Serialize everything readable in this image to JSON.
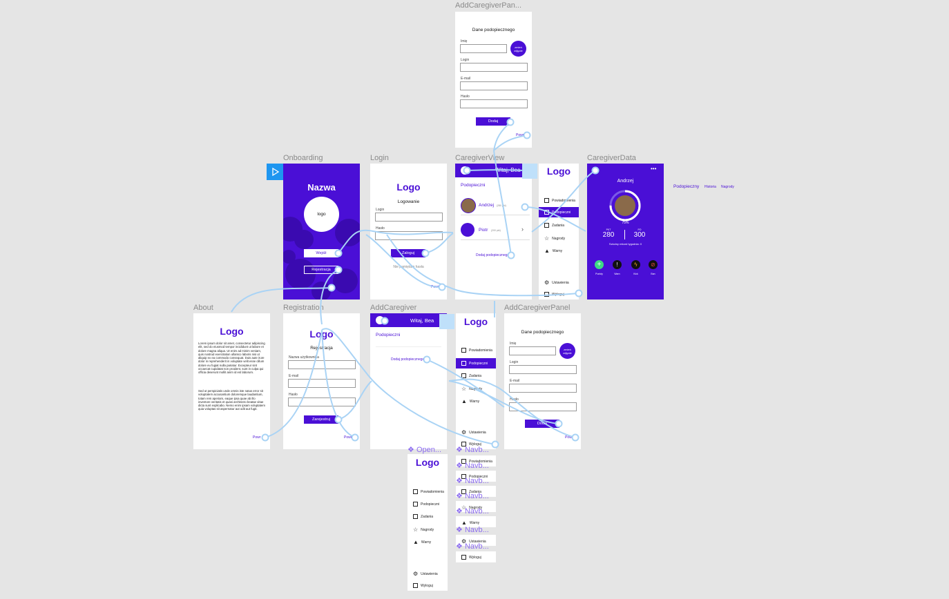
{
  "frames": {
    "add_caregiver_panel_top": "AddCaregiverPan...",
    "onboarding": "Onboarding",
    "login": "Login",
    "caregiver_view": "CaregiverView",
    "caregiver_data": "CaregiverData",
    "about": "About",
    "registration": "Registration",
    "add_caregiver": "AddCaregiver",
    "add_caregiver_panel": "AddCaregiverPanel"
  },
  "components": [
    "Open...",
    "Navb...",
    "Navb...",
    "Navb...",
    "Navb...",
    "Navb...",
    "Navb..."
  ],
  "onboarding": {
    "title": "Nazwa",
    "logo": "logo",
    "enter": "Wejdź",
    "register": "Rejestracja"
  },
  "login": {
    "logo": "Logo",
    "heading": "Logowanie",
    "login_label": "Login",
    "password_label": "Hasło",
    "submit": "Zaloguj",
    "forgot": "Nie pamiętam hasła",
    "back": "Powr"
  },
  "caregiver_view": {
    "greeting": "Witaj, Bea",
    "section": "Podopieczni",
    "wards": [
      {
        "name": "Andrzej",
        "points": "(280 pkt)"
      },
      {
        "name": "Piotr",
        "points": "(200 pkt)"
      }
    ],
    "add": "Dodaj podopiecznego"
  },
  "sidebar": {
    "logo": "Logo",
    "items": [
      "Powiadomienia",
      "Podopieczni",
      "Zadania",
      "Nagrody",
      "Warny"
    ],
    "settings": "Ustawienia",
    "logout": "Wyloguj"
  },
  "caregiver_data": {
    "name": "Andrzej",
    "percent": "75%",
    "pkt_label": "PKT",
    "pkt": "280",
    "po_label": "PO",
    "po": "300",
    "week": "Szkolny rekord tygodnia: 0",
    "actions": [
      "Punkty",
      "Warn",
      "Kick",
      "Ban"
    ],
    "tabs": [
      "Podopieczny",
      "Historia",
      "Nagrody"
    ]
  },
  "about": {
    "logo": "Logo",
    "p1": "Lorem ipsum dolor sit amet, consectetur adipiscing elit, sed do eiusmod tempor incididunt ut labore et dolore magna aliqua. Ut enim ad minim veniam, quis nostrud exercitation ullamco laboris nisi ut aliquip ex ea commodo consequat. Duis aute irure dolor in reprehenderit in voluptate velit esse cillum dolore eu fugiat nulla pariatur. Excepteur sint occaecat cupidatat non proident, sunt in culpa qui officia deserunt mollit anim id est laborum.",
    "p2": "Sed ut perspiciatis unde omnis iste natus error sit voluptatem accusantium doloremque laudantium, totam rem aperiam, eaque ipsa quae ab illo inventore veritatis et quasi architecto beatae vitae dicta sunt explicabo. Nemo enim ipsam voluptatem quia voluptas sit aspernatur aut odit aut fugit.",
    "back": "Powr"
  },
  "registration": {
    "logo": "Logo",
    "heading": "Rejestracja",
    "name_label": "Nazwa użytkownika",
    "email_label": "E-mail",
    "password_label": "Hasło",
    "submit": "Zarejestruj",
    "back": "Powr"
  },
  "add_caregiver": {
    "greeting": "Witaj, Bea",
    "section": "Podopieczni",
    "add": "Dodaj podopiecznego"
  },
  "panel": {
    "heading": "Dane podopiecznego",
    "name_label": "Imię",
    "photo": "zmień zdjęcie",
    "login_label": "Login",
    "email_label": "E-mail",
    "password_label": "Hasło",
    "submit": "Dodaj",
    "back": "Powr"
  },
  "open_logo": "Logo",
  "colors": {
    "accent": "#4a0fd6",
    "wire": "#a9d3f5",
    "canvas": "#e5e5e5",
    "green": "#3ddc84"
  }
}
